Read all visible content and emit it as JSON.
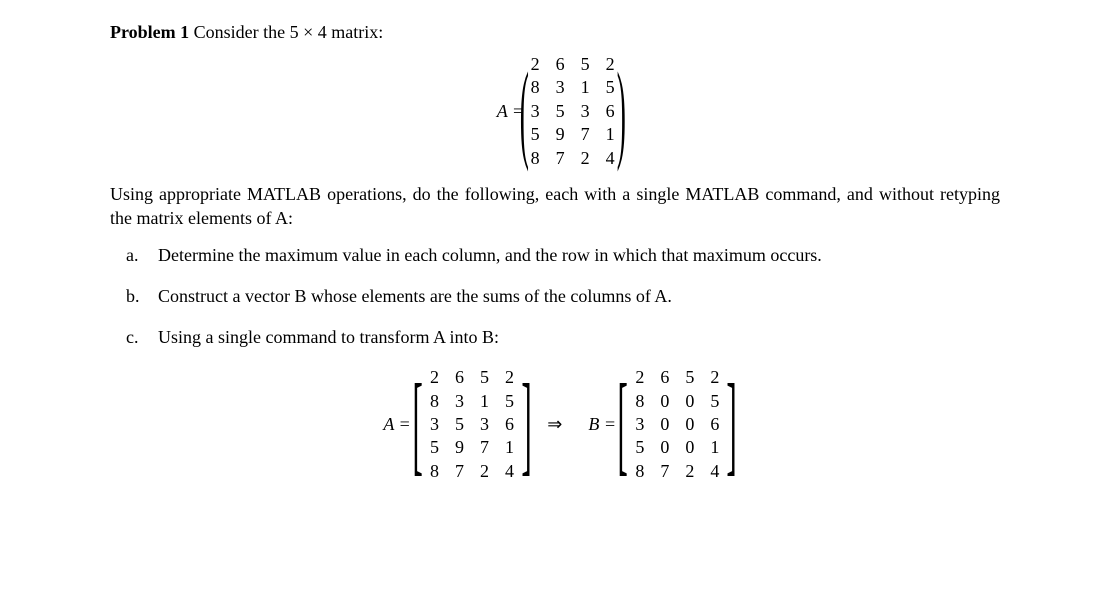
{
  "title_strong": "Problem 1",
  "title_rest": " Consider the 5 × 4 matrix:",
  "assignA": "A =",
  "matrixA": [
    [
      "2",
      "6",
      "5",
      "2"
    ],
    [
      "8",
      "3",
      "1",
      "5"
    ],
    [
      "3",
      "5",
      "3",
      "6"
    ],
    [
      "5",
      "9",
      "7",
      "1"
    ],
    [
      "8",
      "7",
      "2",
      "4"
    ]
  ],
  "paragraph": "Using appropriate MATLAB operations, do the following, each with a single MATLAB command, and without retyping the matrix elements of A:",
  "items": [
    {
      "marker": "a.",
      "text": "Determine the maximum value in each column, and the row in which that maximum occurs."
    },
    {
      "marker": "b.",
      "text": "Construct a vector B whose elements are the sums of the columns of A."
    },
    {
      "marker": "c.",
      "text": "Using a single command to transform A into B:"
    }
  ],
  "assignA2": "A =",
  "matrixA2": [
    [
      "2",
      "6",
      "5",
      "2"
    ],
    [
      "8",
      "3",
      "1",
      "5"
    ],
    [
      "3",
      "5",
      "3",
      "6"
    ],
    [
      "5",
      "9",
      "7",
      "1"
    ],
    [
      "8",
      "7",
      "2",
      "4"
    ]
  ],
  "arrow": "⇒",
  "assignB": "B =",
  "matrixB": [
    [
      "2",
      "6",
      "5",
      "2"
    ],
    [
      "8",
      "0",
      "0",
      "5"
    ],
    [
      "3",
      "0",
      "0",
      "6"
    ],
    [
      "5",
      "0",
      "0",
      "1"
    ],
    [
      "8",
      "7",
      "2",
      "4"
    ]
  ]
}
